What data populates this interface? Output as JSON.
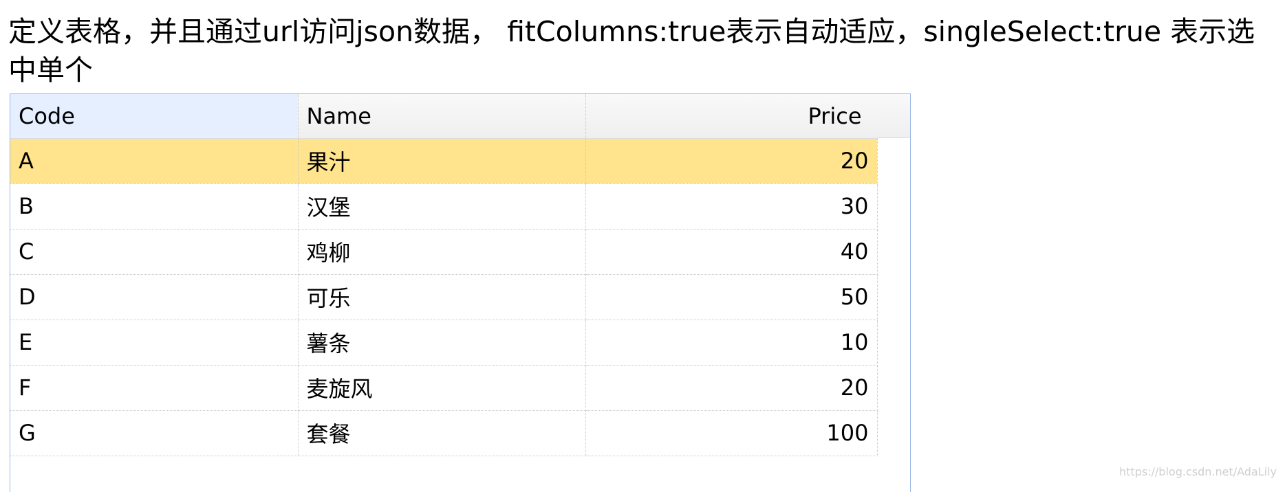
{
  "page": {
    "heading": "定义表格，并且通过url访问json数据， fitColumns:true表示自动适应，singleSelect:true 表示选中单个"
  },
  "grid": {
    "columns": [
      {
        "label": "Code"
      },
      {
        "label": "Name"
      },
      {
        "label": "Price"
      }
    ],
    "selected_row": 0,
    "rows": [
      {
        "code": "A",
        "name": "果汁",
        "price": "20"
      },
      {
        "code": "B",
        "name": "汉堡",
        "price": "30"
      },
      {
        "code": "C",
        "name": "鸡柳",
        "price": "40"
      },
      {
        "code": "D",
        "name": "可乐",
        "price": "50"
      },
      {
        "code": "E",
        "name": "薯条",
        "price": "10"
      },
      {
        "code": "F",
        "name": "麦旋风",
        "price": "20"
      },
      {
        "code": "G",
        "name": "套餐",
        "price": "100"
      }
    ]
  },
  "watermark": "https://blog.csdn.net/AdaLily",
  "colors": {
    "selected_row": "#ffe48d",
    "grid_border": "#95b8e7",
    "sorted_header": "#e6efff"
  }
}
